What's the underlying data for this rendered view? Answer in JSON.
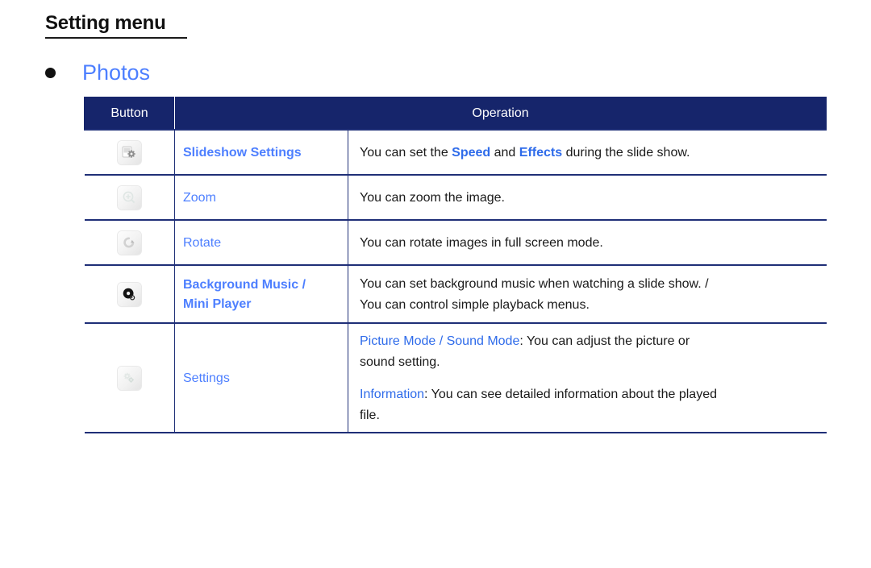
{
  "document": {
    "title": "Setting menu",
    "section": {
      "bullet_icon": "bullet-dot-icon",
      "label": "Photos"
    }
  },
  "table": {
    "headers": {
      "button": "Button",
      "operation": "Operation"
    },
    "rows": [
      {
        "icon": "slideshow-settings-icon",
        "name": "Slideshow Settings",
        "name_bold": true,
        "operation_plain": "You can set the Speed and Effects during the slide show.",
        "op_parts": {
          "a": "You can set the ",
          "b": "Speed",
          "c": " and ",
          "d": "Effects",
          "e": " during the slide show."
        }
      },
      {
        "icon": "zoom-icon",
        "name": "Zoom",
        "name_bold": false,
        "operation_plain": "You can zoom the image."
      },
      {
        "icon": "rotate-icon",
        "name": "Rotate",
        "name_bold": false,
        "operation_plain": "You can rotate images in full screen mode."
      },
      {
        "icon": "background-music-disc-icon",
        "name_line1": "Background Music /",
        "name_line2": "Mini Player",
        "name_bold": true,
        "op_line1": "You can set background music when watching a slide show. /",
        "op_line2": "You can control simple playback menus."
      },
      {
        "icon": "settings-gear-icon",
        "name": "Settings",
        "name_bold": false,
        "op_para1": {
          "label": "Picture Mode / Sound Mode",
          "rest": ": You can adjust the picture or",
          "line2": "sound setting."
        },
        "op_para2": {
          "label": "Information",
          "rest": ": You can see detailed information about the played",
          "line2": "file."
        }
      }
    ]
  },
  "colors": {
    "header_navy": "#16256b",
    "border_navy": "#1f2f77",
    "link_blue": "#4d7fff",
    "inline_blue": "#2e6bea",
    "text_black": "#1a1a1a"
  }
}
